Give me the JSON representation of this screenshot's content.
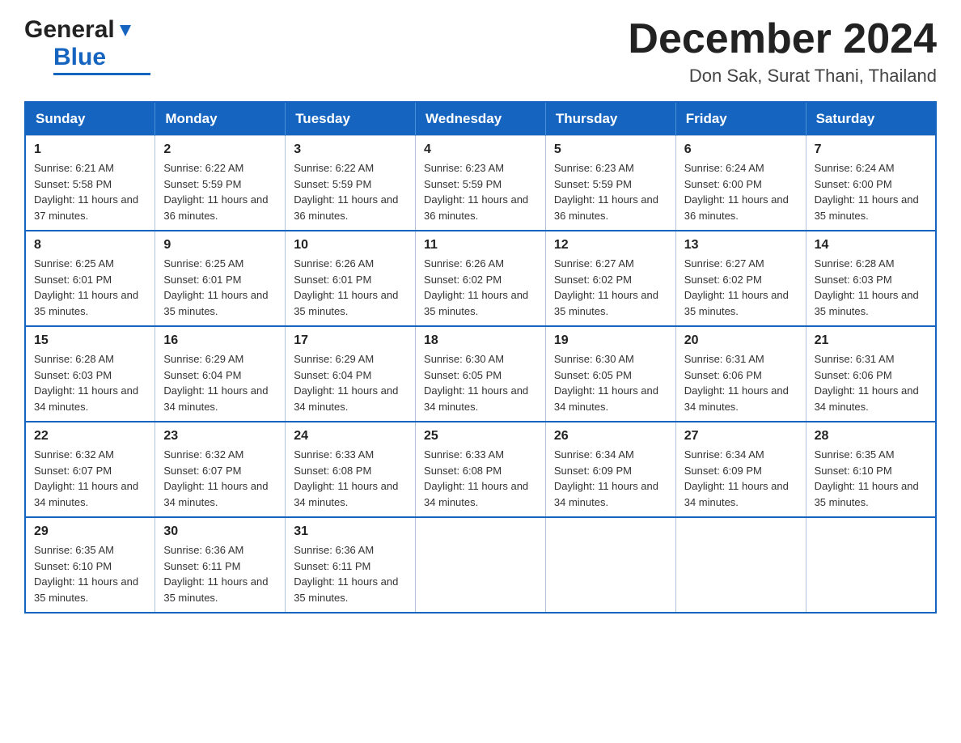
{
  "logo": {
    "general_text": "General",
    "blue_text": "Blue"
  },
  "title": "December 2024",
  "subtitle": "Don Sak, Surat Thani, Thailand",
  "days_of_week": [
    "Sunday",
    "Monday",
    "Tuesday",
    "Wednesday",
    "Thursday",
    "Friday",
    "Saturday"
  ],
  "weeks": [
    [
      {
        "day": "1",
        "sunrise": "6:21 AM",
        "sunset": "5:58 PM",
        "daylight": "11 hours and 37 minutes."
      },
      {
        "day": "2",
        "sunrise": "6:22 AM",
        "sunset": "5:59 PM",
        "daylight": "11 hours and 36 minutes."
      },
      {
        "day": "3",
        "sunrise": "6:22 AM",
        "sunset": "5:59 PM",
        "daylight": "11 hours and 36 minutes."
      },
      {
        "day": "4",
        "sunrise": "6:23 AM",
        "sunset": "5:59 PM",
        "daylight": "11 hours and 36 minutes."
      },
      {
        "day": "5",
        "sunrise": "6:23 AM",
        "sunset": "5:59 PM",
        "daylight": "11 hours and 36 minutes."
      },
      {
        "day": "6",
        "sunrise": "6:24 AM",
        "sunset": "6:00 PM",
        "daylight": "11 hours and 36 minutes."
      },
      {
        "day": "7",
        "sunrise": "6:24 AM",
        "sunset": "6:00 PM",
        "daylight": "11 hours and 35 minutes."
      }
    ],
    [
      {
        "day": "8",
        "sunrise": "6:25 AM",
        "sunset": "6:01 PM",
        "daylight": "11 hours and 35 minutes."
      },
      {
        "day": "9",
        "sunrise": "6:25 AM",
        "sunset": "6:01 PM",
        "daylight": "11 hours and 35 minutes."
      },
      {
        "day": "10",
        "sunrise": "6:26 AM",
        "sunset": "6:01 PM",
        "daylight": "11 hours and 35 minutes."
      },
      {
        "day": "11",
        "sunrise": "6:26 AM",
        "sunset": "6:02 PM",
        "daylight": "11 hours and 35 minutes."
      },
      {
        "day": "12",
        "sunrise": "6:27 AM",
        "sunset": "6:02 PM",
        "daylight": "11 hours and 35 minutes."
      },
      {
        "day": "13",
        "sunrise": "6:27 AM",
        "sunset": "6:02 PM",
        "daylight": "11 hours and 35 minutes."
      },
      {
        "day": "14",
        "sunrise": "6:28 AM",
        "sunset": "6:03 PM",
        "daylight": "11 hours and 35 minutes."
      }
    ],
    [
      {
        "day": "15",
        "sunrise": "6:28 AM",
        "sunset": "6:03 PM",
        "daylight": "11 hours and 34 minutes."
      },
      {
        "day": "16",
        "sunrise": "6:29 AM",
        "sunset": "6:04 PM",
        "daylight": "11 hours and 34 minutes."
      },
      {
        "day": "17",
        "sunrise": "6:29 AM",
        "sunset": "6:04 PM",
        "daylight": "11 hours and 34 minutes."
      },
      {
        "day": "18",
        "sunrise": "6:30 AM",
        "sunset": "6:05 PM",
        "daylight": "11 hours and 34 minutes."
      },
      {
        "day": "19",
        "sunrise": "6:30 AM",
        "sunset": "6:05 PM",
        "daylight": "11 hours and 34 minutes."
      },
      {
        "day": "20",
        "sunrise": "6:31 AM",
        "sunset": "6:06 PM",
        "daylight": "11 hours and 34 minutes."
      },
      {
        "day": "21",
        "sunrise": "6:31 AM",
        "sunset": "6:06 PM",
        "daylight": "11 hours and 34 minutes."
      }
    ],
    [
      {
        "day": "22",
        "sunrise": "6:32 AM",
        "sunset": "6:07 PM",
        "daylight": "11 hours and 34 minutes."
      },
      {
        "day": "23",
        "sunrise": "6:32 AM",
        "sunset": "6:07 PM",
        "daylight": "11 hours and 34 minutes."
      },
      {
        "day": "24",
        "sunrise": "6:33 AM",
        "sunset": "6:08 PM",
        "daylight": "11 hours and 34 minutes."
      },
      {
        "day": "25",
        "sunrise": "6:33 AM",
        "sunset": "6:08 PM",
        "daylight": "11 hours and 34 minutes."
      },
      {
        "day": "26",
        "sunrise": "6:34 AM",
        "sunset": "6:09 PM",
        "daylight": "11 hours and 34 minutes."
      },
      {
        "day": "27",
        "sunrise": "6:34 AM",
        "sunset": "6:09 PM",
        "daylight": "11 hours and 34 minutes."
      },
      {
        "day": "28",
        "sunrise": "6:35 AM",
        "sunset": "6:10 PM",
        "daylight": "11 hours and 35 minutes."
      }
    ],
    [
      {
        "day": "29",
        "sunrise": "6:35 AM",
        "sunset": "6:10 PM",
        "daylight": "11 hours and 35 minutes."
      },
      {
        "day": "30",
        "sunrise": "6:36 AM",
        "sunset": "6:11 PM",
        "daylight": "11 hours and 35 minutes."
      },
      {
        "day": "31",
        "sunrise": "6:36 AM",
        "sunset": "6:11 PM",
        "daylight": "11 hours and 35 minutes."
      },
      null,
      null,
      null,
      null
    ]
  ],
  "labels": {
    "sunrise": "Sunrise:",
    "sunset": "Sunset:",
    "daylight": "Daylight:"
  },
  "colors": {
    "header_bg": "#1565c0",
    "header_text": "#ffffff",
    "border": "#1565c0"
  }
}
